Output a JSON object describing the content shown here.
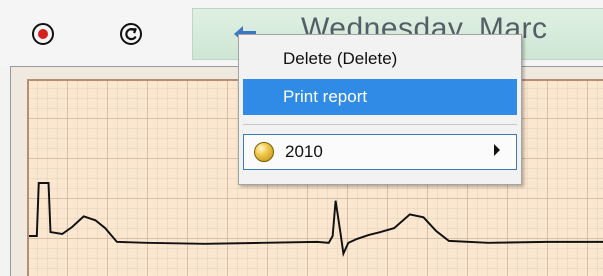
{
  "toolbar": {
    "record_icon": "record-icon",
    "undo_icon": "undo-icon",
    "back_icon": "back-arrow-icon",
    "date_label": "Wednesday, Marc"
  },
  "context_menu": {
    "items": [
      {
        "label": "Delete (Delete)"
      },
      {
        "label": "Print report"
      },
      {
        "label": "2010",
        "icon": "year-icon"
      }
    ]
  },
  "colors": {
    "menu_highlight": "#2f8be5",
    "date_bar": "#d9ecdd",
    "ecg_paper": "#fbe7cf",
    "record_red": "#d61f1f"
  }
}
